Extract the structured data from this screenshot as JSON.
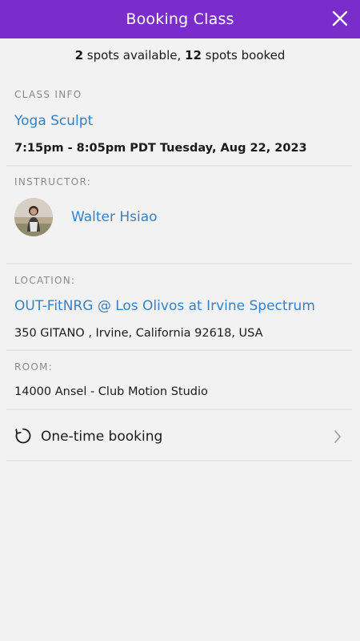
{
  "header": {
    "title": "Booking Class",
    "close_icon": "close-icon"
  },
  "availability": {
    "available_count": "2",
    "available_text": " spots available, ",
    "booked_count": "12",
    "booked_text": " spots booked"
  },
  "class_info": {
    "label": "CLASS INFO",
    "name": "Yoga Sculpt",
    "datetime": "7:15pm - 8:05pm PDT Tuesday, Aug 22, 2023"
  },
  "instructor": {
    "label": "INSTRUCTOR:",
    "name": "Walter Hsiao"
  },
  "location": {
    "label": "LOCATION:",
    "name": "OUT-FitNRG @ Los Olivos at Irvine Spectrum",
    "address": "350 GITANO , Irvine, California 92618, USA"
  },
  "room": {
    "label": "ROOM:",
    "name": "14000 Ansel - Club Motion Studio"
  },
  "booking": {
    "label": "One-time booking",
    "icon": "refresh-icon",
    "chevron": "chevron-right-icon"
  },
  "colors": {
    "header_bg": "#7b2dcc",
    "link": "#2f83d1",
    "background": "#f2f2f2"
  }
}
